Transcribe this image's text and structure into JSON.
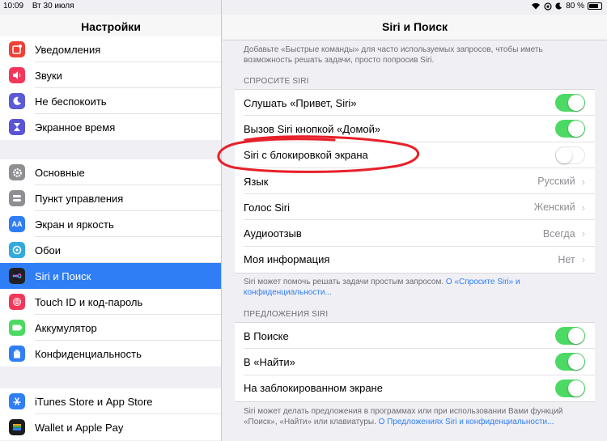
{
  "status": {
    "time": "10:09",
    "date": "Вт 30 июля",
    "battery": "80 %"
  },
  "left": {
    "title": "Настройки",
    "group1": [
      {
        "label": "Уведомления",
        "icon": "notifications-icon",
        "color": "#f04137"
      },
      {
        "label": "Звуки",
        "icon": "sounds-icon",
        "color": "#f2385a"
      },
      {
        "label": "Не беспокоить",
        "icon": "moon-icon",
        "color": "#5b5bd6"
      },
      {
        "label": "Экранное время",
        "icon": "hourglass-icon",
        "color": "#5a55d6"
      }
    ],
    "group2": [
      {
        "label": "Основные",
        "icon": "gear-icon",
        "color": "#8e8e93"
      },
      {
        "label": "Пункт управления",
        "icon": "control-center-icon",
        "color": "#8e8e93"
      },
      {
        "label": "Экран и яркость",
        "icon": "display-icon",
        "color": "#2f7ef6",
        "glyph": "AA"
      },
      {
        "label": "Обои",
        "icon": "wallpaper-icon",
        "color": "#34aadc"
      },
      {
        "label": "Siri и Поиск",
        "icon": "siri-icon",
        "color": "#222",
        "selected": true
      },
      {
        "label": "Touch ID и код-пароль",
        "icon": "fingerprint-icon",
        "color": "#f2385a"
      },
      {
        "label": "Аккумулятор",
        "icon": "battery-icon",
        "color": "#4cd964"
      },
      {
        "label": "Конфиденциальность",
        "icon": "hand-icon",
        "color": "#2f7ef6"
      }
    ],
    "group3": [
      {
        "label": "iTunes Store и App Store",
        "icon": "app-store-icon",
        "color": "#2f7ef6"
      },
      {
        "label": "Wallet и Apple Pay",
        "icon": "wallet-icon",
        "color": "#1c1c1e"
      }
    ]
  },
  "right": {
    "title": "Siri и Поиск",
    "top_note": "Добавьте «Быстрые команды» для часто используемых запросов, чтобы иметь возможность решать задачи, просто попросив Siri.",
    "section1_title": "СПРОСИТЕ SIRI",
    "section1_rows": [
      {
        "label": "Слушать «Привет, Siri»",
        "toggle": "on"
      },
      {
        "label": "Вызов Siri кнопкой «Домой»",
        "toggle": "on"
      },
      {
        "label": "Siri с блокировкой экрана",
        "toggle": "off"
      },
      {
        "label": "Язык",
        "value": "Русский"
      },
      {
        "label": "Голос Siri",
        "value": "Женский"
      },
      {
        "label": "Аудиоотзыв",
        "value": "Всегда"
      },
      {
        "label": "Моя информация",
        "value": "Нет"
      }
    ],
    "section1_note": "Siri может помочь решать задачи простым запросом.",
    "section1_note_link": "О «Спросите Siri» и конфиденциальности...",
    "section2_title": "ПРЕДЛОЖЕНИЯ SIRI",
    "section2_rows": [
      {
        "label": "В Поиске",
        "toggle": "on"
      },
      {
        "label": "В «Найти»",
        "toggle": "on"
      },
      {
        "label": "На заблокированном экране",
        "toggle": "on"
      }
    ],
    "section2_note": "Siri может делать предложения в программах или при использовании Вами функций «Поиск», «Найти» или клавиатуры.",
    "section2_note_link": "О Предложениях Siri и конфиденциальности...",
    "chevron": "›"
  },
  "colors": {
    "accent": "#2f7ef6",
    "toggle_on": "#4cd964",
    "annotation": "#e8202a"
  }
}
